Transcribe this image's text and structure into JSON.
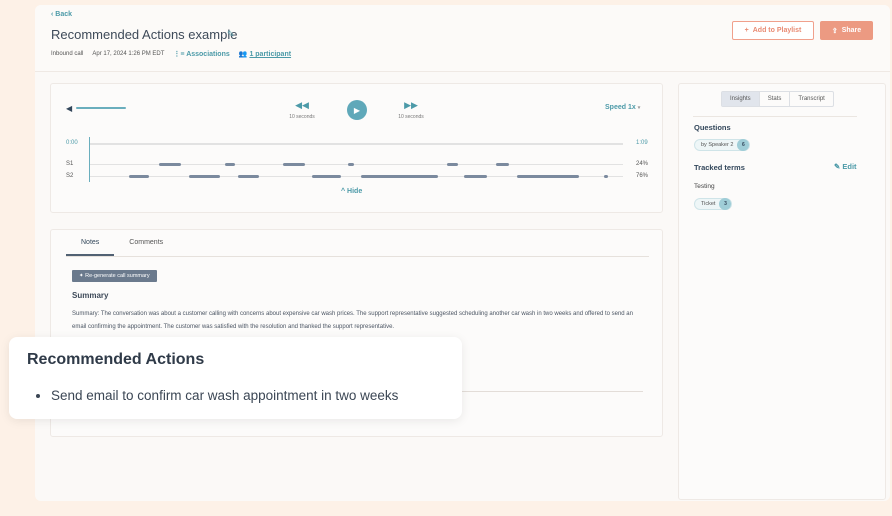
{
  "header": {
    "back": "‹ Back",
    "title": "Recommended Actions example",
    "call_type": "Inbound call",
    "datetime": "Apr 17, 2024 1:26 PM EDT",
    "associations": "Associations",
    "participants": "1 participant",
    "add_to_playlist": "Add to Playlist",
    "share": "Share"
  },
  "player": {
    "rewind_label": "10 seconds",
    "forward_label": "10 seconds",
    "speed": "Speed 1x",
    "start_time": "0:00",
    "end_time": "1:09",
    "hide": "Hide",
    "volume_level": 0.7,
    "speakers": [
      {
        "label": "S1",
        "percent": "24%",
        "segments_seconds": [
          [
            8.9,
            11.8
          ],
          [
            17.5,
            18.8
          ],
          [
            25.0,
            27.8
          ],
          [
            33.4,
            34.2
          ],
          [
            46.2,
            47.6
          ],
          [
            52.6,
            54.2
          ]
        ]
      },
      {
        "label": "S2",
        "percent": "76%",
        "segments_seconds": [
          [
            5.0,
            7.6
          ],
          [
            12.8,
            16.8
          ],
          [
            19.2,
            21.9
          ],
          [
            28.7,
            32.5
          ],
          [
            35.1,
            45.1
          ],
          [
            48.4,
            51.4
          ],
          [
            55.3,
            63.3
          ],
          [
            66.6,
            67.0
          ]
        ]
      }
    ],
    "duration_seconds": 69
  },
  "notes": {
    "tabs": [
      "Notes",
      "Comments"
    ],
    "regenerate": "Re-generate call summary",
    "summary_heading": "Summary",
    "summary_text": "Summary: The conversation was about a customer calling with concerns about expensive car wash prices. The support representative suggested scheduling another car wash in two weeks and offered to send an email confirming the appointment. The customer was satisfied with the resolution and thanked the support representative."
  },
  "overlay": {
    "heading": "Recommended Actions",
    "items": [
      "Send email to confirm car wash appointment in two weeks"
    ]
  },
  "sidebar": {
    "tabs": [
      "Insights",
      "Stats",
      "Transcript"
    ],
    "questions_heading": "Questions",
    "questions_chip": "by Speaker 2",
    "questions_count": "6",
    "tracked_heading": "Tracked terms",
    "edit": "Edit",
    "term_group": "Testing",
    "term_chip": "Ticket",
    "term_count": "3"
  },
  "colors": {
    "accent": "#4c9aa8",
    "brand": "#ec9a82",
    "segment": "#7b8a9e"
  }
}
